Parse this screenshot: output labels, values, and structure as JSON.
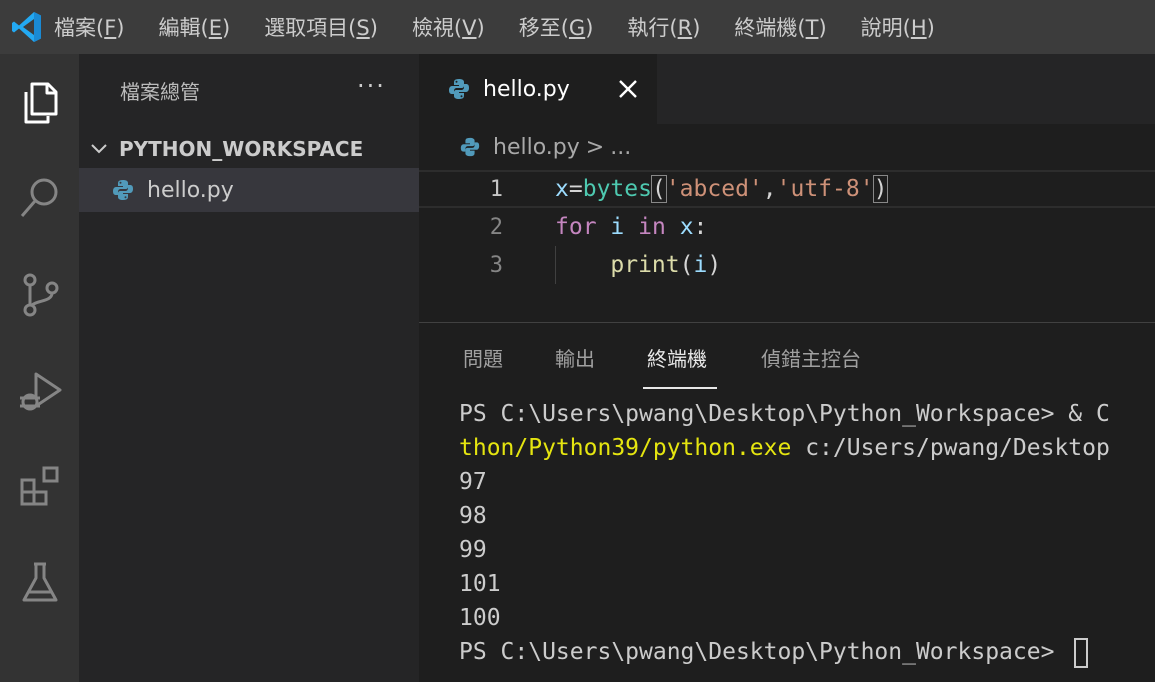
{
  "menubar": {
    "logo_icon": "vscode-logo-icon",
    "items": [
      {
        "label": "檔案(",
        "mnemonic": "F",
        "end": ")"
      },
      {
        "label": "編輯(",
        "mnemonic": "E",
        "end": ")"
      },
      {
        "label": "選取項目(",
        "mnemonic": "S",
        "end": ")"
      },
      {
        "label": "檢視(",
        "mnemonic": "V",
        "end": ")"
      },
      {
        "label": "移至(",
        "mnemonic": "G",
        "end": ")"
      },
      {
        "label": "執行(",
        "mnemonic": "R",
        "end": ")"
      },
      {
        "label": "終端機(",
        "mnemonic": "T",
        "end": ")"
      },
      {
        "label": "說明(",
        "mnemonic": "H",
        "end": ")"
      }
    ]
  },
  "activitybar": {
    "icons": [
      "explorer-icon",
      "search-icon",
      "source-control-icon",
      "run-debug-icon",
      "extensions-icon",
      "testing-icon"
    ]
  },
  "sidebar": {
    "title": "檔案總管",
    "more": "···",
    "folder": "PYTHON_WORKSPACE",
    "file": "hello.py"
  },
  "tabs": [
    {
      "label": "hello.py",
      "icon": "python-file-icon",
      "close_icon": "close-icon"
    }
  ],
  "breadcrumb": {
    "file": "hello.py",
    "separator": ">",
    "more": "..."
  },
  "editor": {
    "line_numbers": [
      "1",
      "2",
      "3"
    ],
    "active_line": 1,
    "lines": [
      [
        {
          "t": "x",
          "c": "v"
        },
        {
          "t": "=",
          "c": ""
        },
        {
          "t": "bytes",
          "c": "bt"
        },
        {
          "t": "(",
          "c": "br"
        },
        {
          "t": "'abced'",
          "c": "s"
        },
        {
          "t": ",",
          "c": ""
        },
        {
          "t": "'utf-8'",
          "c": "s"
        },
        {
          "t": ")",
          "c": "br"
        }
      ],
      [
        {
          "t": "for",
          "c": "k"
        },
        {
          "t": " ",
          "c": ""
        },
        {
          "t": "i",
          "c": "v"
        },
        {
          "t": " ",
          "c": ""
        },
        {
          "t": "in",
          "c": "k"
        },
        {
          "t": " ",
          "c": ""
        },
        {
          "t": "x",
          "c": "v"
        },
        {
          "t": ":",
          "c": ""
        }
      ],
      [
        {
          "t": "    ",
          "c": ""
        },
        {
          "t": "print",
          "c": "f"
        },
        {
          "t": "(",
          "c": ""
        },
        {
          "t": "i",
          "c": "v"
        },
        {
          "t": ")",
          "c": ""
        }
      ]
    ]
  },
  "panel": {
    "tabs": [
      "問題",
      "輸出",
      "終端機",
      "偵錯主控台"
    ],
    "active_tab": "終端機",
    "terminal": {
      "line1_prompt": "PS C:\\Users\\pwang\\Desktop\\Python_Workspace> ",
      "line1_amp": "& C",
      "line2_exe": "thon/Python39/python.exe",
      "line2_rest": " c:/Users/pwang/Desktop",
      "outputs": [
        "97",
        "98",
        "99",
        "101",
        "100"
      ],
      "last_prompt": "PS C:\\Users\\pwang\\Desktop\\Python_Workspace> "
    }
  },
  "colors": {
    "menubar_bg": "#3c3c3c",
    "activitybar_bg": "#333333",
    "sidebar_bg": "#252526",
    "editor_bg": "#1e1e1e",
    "vscode_blue": "#23a9f2",
    "terminal_yellow": "#e5e510"
  }
}
